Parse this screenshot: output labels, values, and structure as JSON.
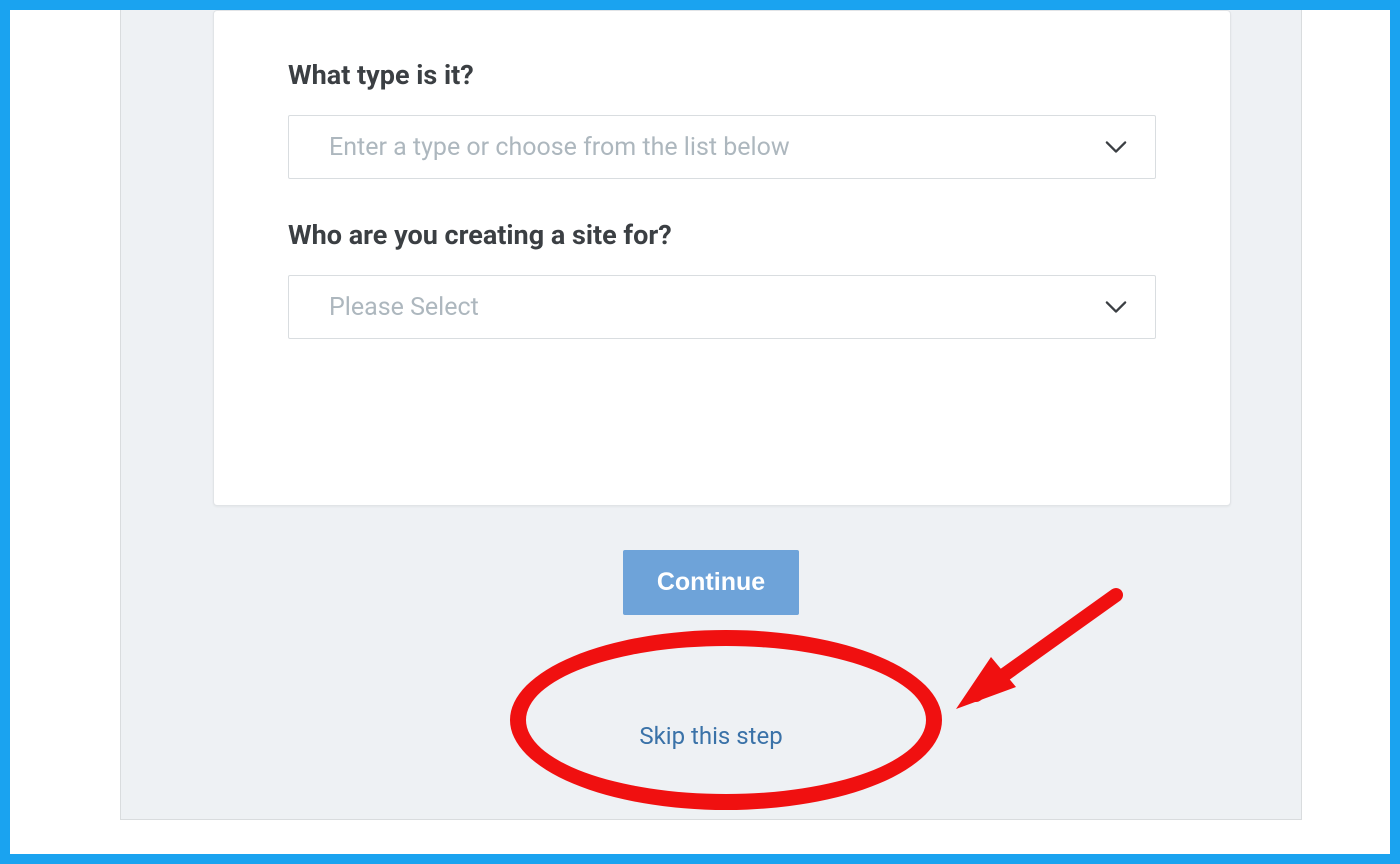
{
  "form": {
    "question1_label": "What type is it?",
    "type_dropdown_placeholder": "Enter a type or choose from the list below",
    "question2_label": "Who are you creating a site for?",
    "audience_dropdown_placeholder": "Please Select"
  },
  "actions": {
    "continue_label": "Continue",
    "skip_label": "Skip this step"
  }
}
